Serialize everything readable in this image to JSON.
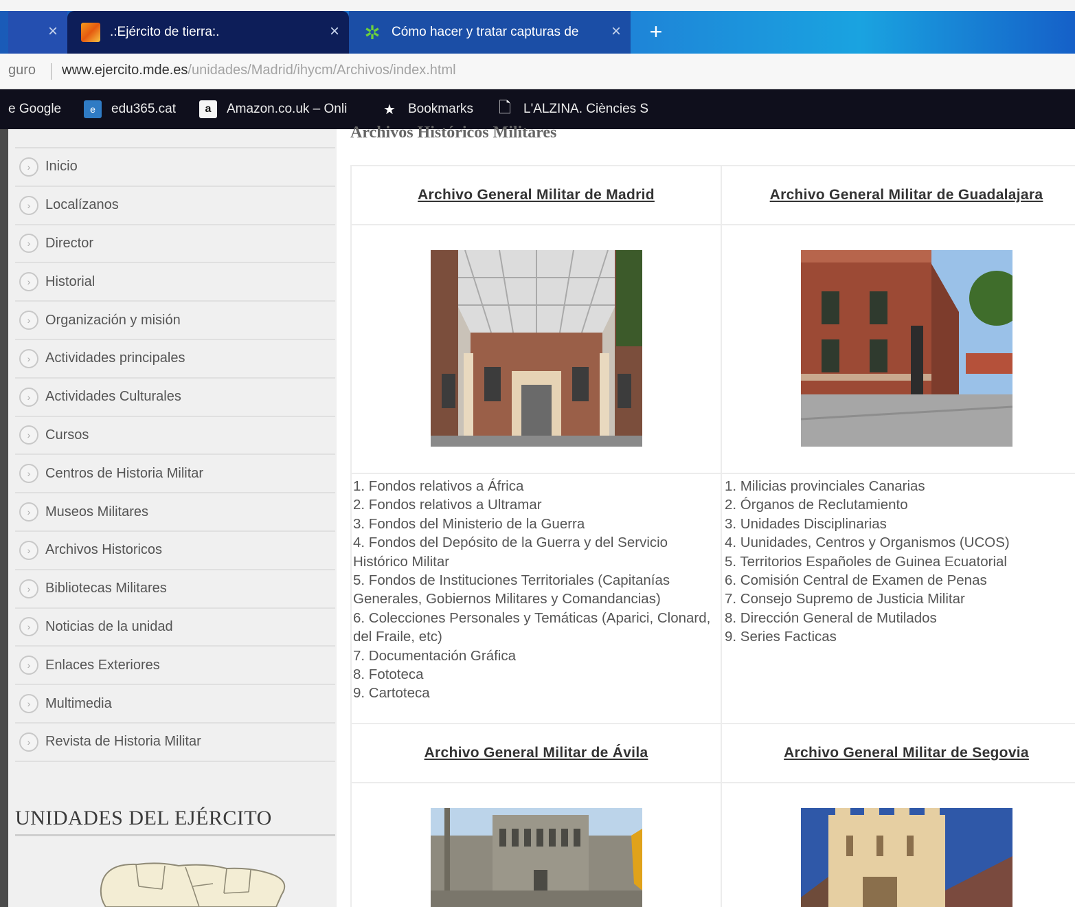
{
  "browser": {
    "tabs": [
      {
        "title": "",
        "close": "×"
      },
      {
        "title": ".:Ejército de tierra:.",
        "close": "×"
      },
      {
        "title": "Cómo hacer y tratar capturas de",
        "close": "×"
      }
    ],
    "new_tab": "+",
    "address": {
      "secure_label": "guro",
      "url_host": "www.ejercito.mde.es",
      "url_path": "/unidades/Madrid/ihycm/Archivos/index.html"
    },
    "bookmarks": [
      {
        "label": "e Google",
        "icon": "none"
      },
      {
        "label": "edu365.cat",
        "icon": "edu365-icon"
      },
      {
        "label": "Amazon.co.uk – Onli",
        "icon": "amazon-icon"
      },
      {
        "label": "Bookmarks",
        "icon": "star-icon"
      },
      {
        "label": "L'ALZINA. Ciències S",
        "icon": "document-icon"
      }
    ]
  },
  "sidebar": {
    "menu": [
      "Inicio",
      "Localízanos",
      "Director",
      "Historial",
      "Organización y misión",
      "Actividades principales",
      "Actividades Culturales",
      "Cursos",
      "Centros de Historia Militar",
      "Museos Militares",
      "Archivos Historicos",
      "Bibliotecas Militares",
      "Noticias de la unidad",
      "Enlaces Exteriores",
      "Multimedia",
      "Revista de Historia Militar"
    ],
    "units_title": "UNIDADES DEL EJÉRCITO"
  },
  "content": {
    "heading": "Archivos Históricos Militares",
    "archives": [
      {
        "title": "Archivo General Militar de Madrid",
        "items": [
          "1. Fondos relativos a África",
          "2. Fondos relativos a Ultramar",
          "3. Fondos del Ministerio de la Guerra",
          "4. Fondos del Depósito de la Guerra y del Servicio Histórico Militar",
          "5. Fondos de Instituciones Territoriales (Capitanías Generales, Gobiernos Militares y Comandancias)",
          "6. Colecciones Personales y Temáticas (Aparici, Clonard, del Fraile, etc)",
          "7. Documentación Gráfica",
          "8. Fototeca",
          "9. Cartoteca"
        ]
      },
      {
        "title": "Archivo General Militar de Guadalajara",
        "items": [
          "1. Milicias provinciales Canarias",
          "2. Órganos de Reclutamiento",
          "3. Unidades Disciplinarias",
          "4. Uunidades, Centros y Organismos (UCOS)",
          "5. Territorios Españoles de Guinea Ecuatorial",
          "6. Comisión Central de Examen de Penas",
          "7. Consejo Supremo de Justicia Militar",
          "8. Dirección General de Mutilados",
          "9. Series Facticas"
        ]
      },
      {
        "title": "Archivo General Militar de Ávila",
        "items": []
      },
      {
        "title": "Archivo General Militar de Segovia",
        "items": []
      }
    ]
  }
}
